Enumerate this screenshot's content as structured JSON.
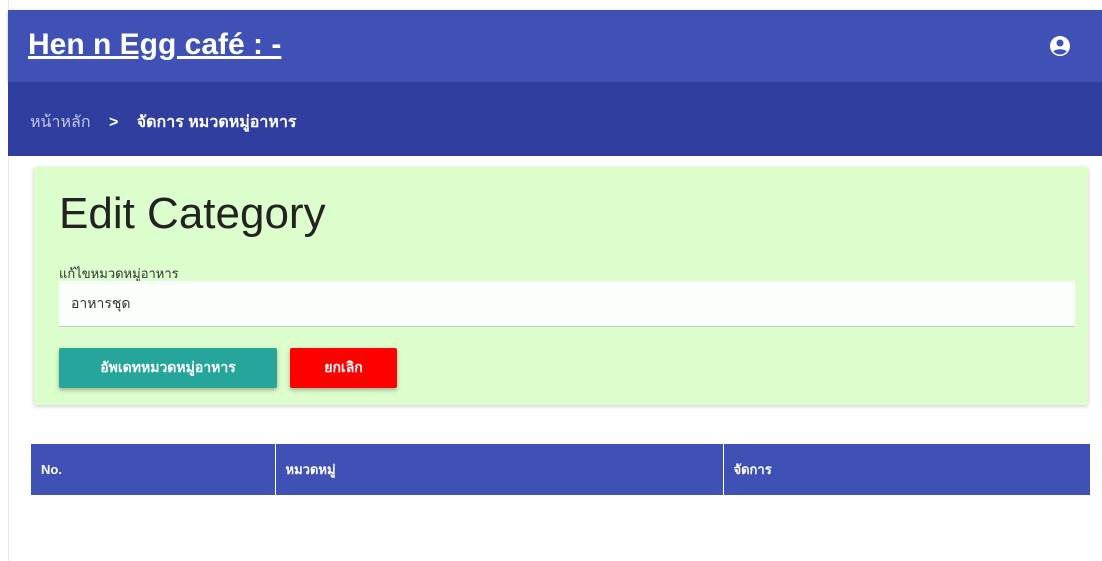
{
  "header": {
    "title": "Hen n Egg café : -",
    "account_icon": "account-circle-icon"
  },
  "breadcrumb": {
    "home": "หน้าหลัก",
    "separator": ">",
    "current": "จัดการ หมวดหมู่อาหาร"
  },
  "edit_form": {
    "title": "Edit Category",
    "field_label": "แก้ไขหมวดหมู่อาหาร",
    "field_value": "อาหารชุด",
    "update_button": "อัพเดทหมวดหมู่อาหาร",
    "cancel_button": "ยกเลิก"
  },
  "table": {
    "columns": [
      "No.",
      "หมวดหมู่",
      "จัดการ"
    ],
    "rows": []
  },
  "colors": {
    "header": "#3f51b5",
    "breadcrumb_bar": "#303f9f",
    "card_background": "#dcfdcc",
    "update_button": "#26a69a",
    "cancel_button": "#ff0000"
  }
}
